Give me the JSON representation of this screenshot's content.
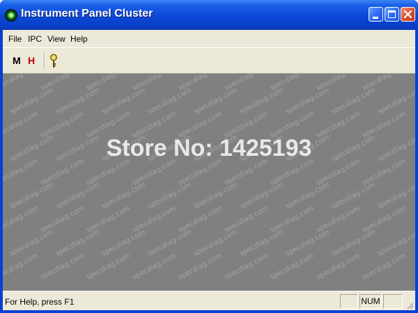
{
  "window": {
    "title": "Instrument Panel Cluster",
    "controls": [
      "minimize",
      "maximize",
      "close"
    ]
  },
  "menu": {
    "items": [
      "File",
      "IPC",
      "View",
      "Help"
    ]
  },
  "toolbar": {
    "m_label": "M",
    "h_label": "H",
    "help_icon": "help-key-icon",
    "colors": {
      "m": "#000000",
      "h": "#c00000",
      "help": "#c8b400"
    }
  },
  "content": {
    "overlay_text": "Store No: 1425193",
    "watermark_text": "specdiag.com",
    "background_color": "#808080"
  },
  "statusbar": {
    "message": "For Help, press F1",
    "panes": [
      "",
      "NUM",
      ""
    ]
  }
}
